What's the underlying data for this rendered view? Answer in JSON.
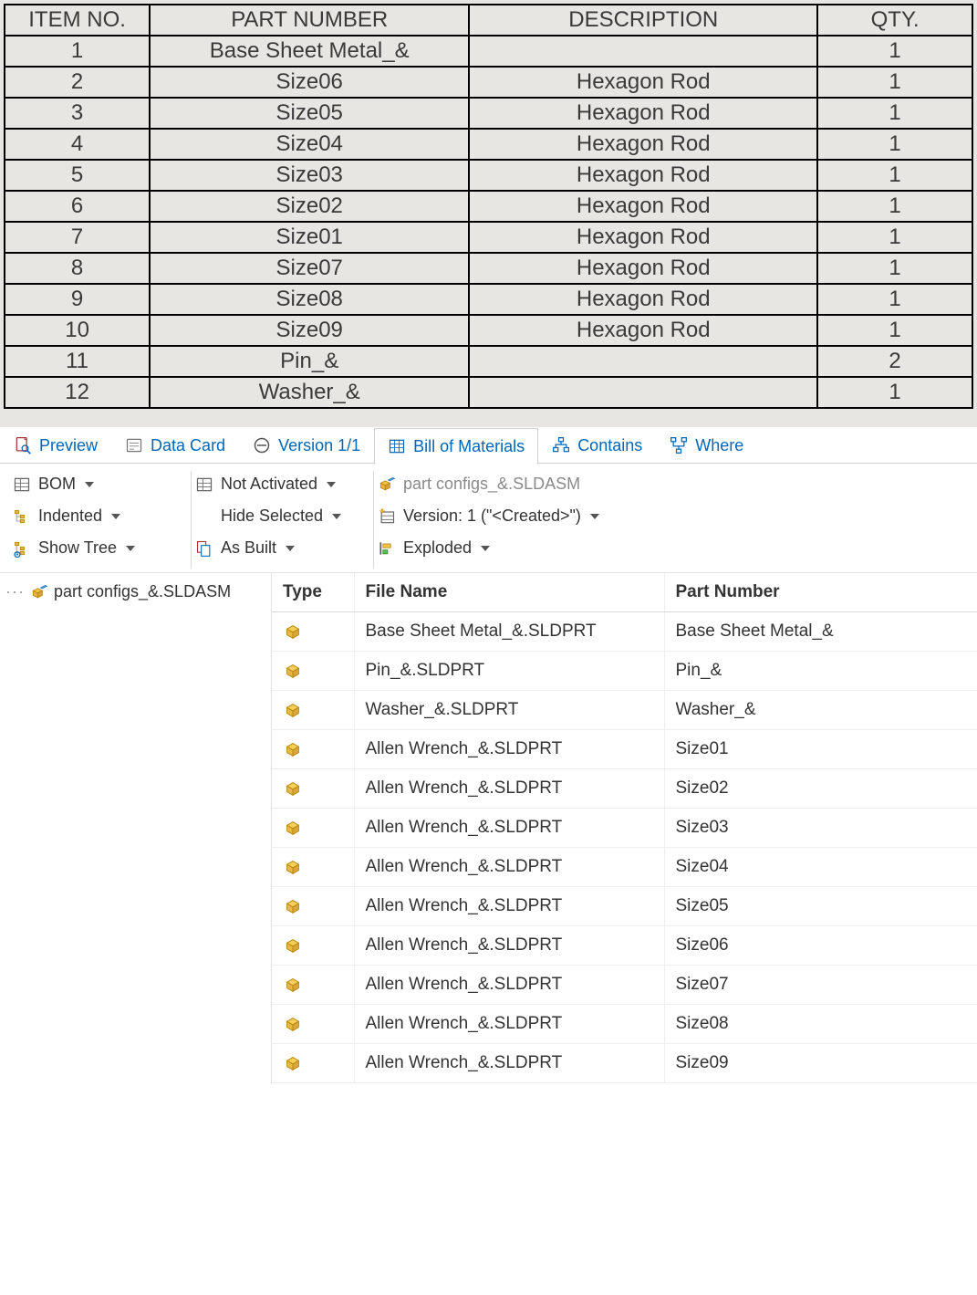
{
  "bom_table": {
    "headers": {
      "item": "ITEM NO.",
      "part": "PART NUMBER",
      "desc": "DESCRIPTION",
      "qty": "QTY."
    },
    "rows": [
      {
        "item": "1",
        "part": "Base Sheet Metal_&",
        "desc": "",
        "qty": "1"
      },
      {
        "item": "2",
        "part": "Size06",
        "desc": "Hexagon Rod",
        "qty": "1"
      },
      {
        "item": "3",
        "part": "Size05",
        "desc": "Hexagon Rod",
        "qty": "1"
      },
      {
        "item": "4",
        "part": "Size04",
        "desc": "Hexagon Rod",
        "qty": "1"
      },
      {
        "item": "5",
        "part": "Size03",
        "desc": "Hexagon Rod",
        "qty": "1"
      },
      {
        "item": "6",
        "part": "Size02",
        "desc": "Hexagon Rod",
        "qty": "1"
      },
      {
        "item": "7",
        "part": "Size01",
        "desc": "Hexagon Rod",
        "qty": "1"
      },
      {
        "item": "8",
        "part": "Size07",
        "desc": "Hexagon Rod",
        "qty": "1"
      },
      {
        "item": "9",
        "part": "Size08",
        "desc": "Hexagon Rod",
        "qty": "1"
      },
      {
        "item": "10",
        "part": "Size09",
        "desc": "Hexagon Rod",
        "qty": "1"
      },
      {
        "item": "11",
        "part": "Pin_&",
        "desc": "",
        "qty": "2"
      },
      {
        "item": "12",
        "part": "Washer_&",
        "desc": "",
        "qty": "1"
      }
    ]
  },
  "tabs": {
    "preview": "Preview",
    "datacard": "Data Card",
    "version": "Version 1/1",
    "bom": "Bill of Materials",
    "contains": "Contains",
    "where": "Where"
  },
  "toolbar": {
    "bom": "BOM",
    "indented": "Indented",
    "show_tree": "Show Tree",
    "not_activated": "Not Activated",
    "hide_selected": "Hide Selected",
    "as_built": "As Built",
    "file_label": "part configs_&.SLDASM",
    "version_label": "Version: 1 (\"<Created>\")",
    "exploded": "Exploded"
  },
  "tree": {
    "root": "part configs_&.SLDASM"
  },
  "grid": {
    "headers": {
      "type": "Type",
      "file": "File Name",
      "part": "Part Number"
    },
    "rows": [
      {
        "file": "Base Sheet Metal_&.SLDPRT",
        "part": "Base Sheet Metal_&"
      },
      {
        "file": "Pin_&.SLDPRT",
        "part": "Pin_&"
      },
      {
        "file": "Washer_&.SLDPRT",
        "part": "Washer_&"
      },
      {
        "file": "Allen Wrench_&.SLDPRT",
        "part": "Size01"
      },
      {
        "file": "Allen Wrench_&.SLDPRT",
        "part": "Size02"
      },
      {
        "file": "Allen Wrench_&.SLDPRT",
        "part": "Size03"
      },
      {
        "file": "Allen Wrench_&.SLDPRT",
        "part": "Size04"
      },
      {
        "file": "Allen Wrench_&.SLDPRT",
        "part": "Size05"
      },
      {
        "file": "Allen Wrench_&.SLDPRT",
        "part": "Size06"
      },
      {
        "file": "Allen Wrench_&.SLDPRT",
        "part": "Size07"
      },
      {
        "file": "Allen Wrench_&.SLDPRT",
        "part": "Size08"
      },
      {
        "file": "Allen Wrench_&.SLDPRT",
        "part": "Size09"
      }
    ]
  }
}
